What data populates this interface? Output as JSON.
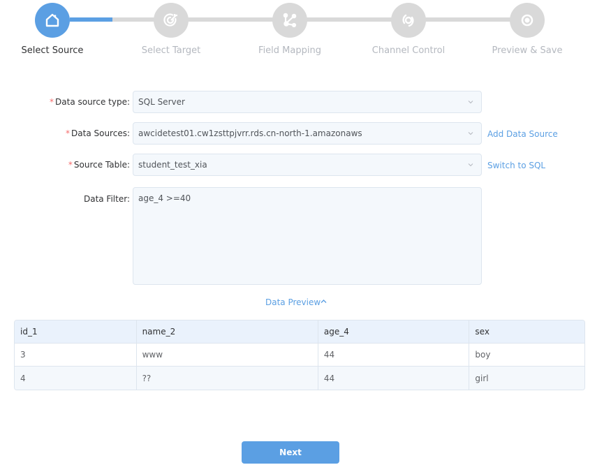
{
  "steps": [
    {
      "label": "Select Source",
      "icon": "home-icon",
      "active": true
    },
    {
      "label": "Select Target",
      "icon": "target-icon",
      "active": false
    },
    {
      "label": "Field Mapping",
      "icon": "share-nodes-icon",
      "active": false
    },
    {
      "label": "Channel Control",
      "icon": "loading-ring-icon",
      "active": false
    },
    {
      "label": "Preview & Save",
      "icon": "eye-icon",
      "active": false
    }
  ],
  "colors": {
    "accent": "#5b9fe3",
    "inactive": "#d9d9d9",
    "required": "#f56c6c"
  },
  "form": {
    "required_mark": "*",
    "source_type": {
      "label": "Data source type:",
      "value": "SQL Server"
    },
    "data_sources": {
      "label": "Data Sources:",
      "value": "awcidetest01.cw1zsttpjvrr.rds.cn-north-1.amazonaws",
      "link": "Add Data Source"
    },
    "source_table": {
      "label": "Source Table:",
      "value": "student_test_xia",
      "link": "Switch to SQL"
    },
    "data_filter": {
      "label": "Data Filter:",
      "value": "age_4 >=40"
    }
  },
  "preview": {
    "toggle_label": "Data Preview",
    "columns": [
      "id_1",
      "name_2",
      "age_4",
      "sex"
    ],
    "rows": [
      [
        "3",
        "www",
        "44",
        "boy"
      ],
      [
        "4",
        "??",
        "44",
        "girl"
      ]
    ]
  },
  "footer": {
    "next_label": "Next"
  }
}
